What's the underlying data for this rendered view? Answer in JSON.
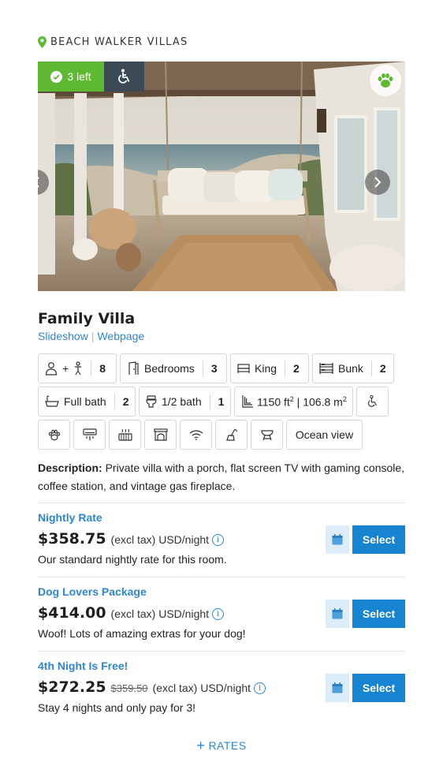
{
  "location": {
    "text": "BEACH WALKER VILLAS",
    "icon": "map-pin-icon"
  },
  "photo": {
    "availability_label": "3 left",
    "accessible_icon": "wheelchair-icon",
    "pet_icon": "paw-icon",
    "next_icon": "chevron-right-icon"
  },
  "room": {
    "title": "Family Villa",
    "links": {
      "slideshow": "Slideshow",
      "separator": "|",
      "webpage": "Webpage"
    }
  },
  "amenities": {
    "occupancy": {
      "icon": "adult-child-icon",
      "label": "+",
      "count": "8"
    },
    "bedrooms": {
      "icon": "door-icon",
      "label": "Bedrooms",
      "count": "3"
    },
    "king": {
      "icon": "king-bed-icon",
      "label": "King",
      "count": "2"
    },
    "bunk": {
      "icon": "bunk-bed-icon",
      "label": "Bunk",
      "count": "2"
    },
    "full_bath": {
      "icon": "bathtub-icon",
      "label": "Full bath",
      "count": "2"
    },
    "half_bath": {
      "icon": "toilet-icon",
      "label": "1/2 bath",
      "count": "1"
    },
    "area": {
      "icon": "area-icon",
      "ft": "1150 ft",
      "sq": "2",
      "sep": " | ",
      "m": "106.8 m"
    },
    "features": [
      "wheelchair-icon",
      "paw-icon",
      "air-conditioner-icon",
      "heater-icon",
      "fireplace-icon",
      "wifi-icon",
      "vacuum-icon",
      "bbq-grill-icon"
    ],
    "view": "Ocean view"
  },
  "description": {
    "label": "Description:",
    "text": " Private villa with a porch, flat screen TV with gaming console, coffee station, and vintage gas fireplace."
  },
  "rates": [
    {
      "name": "Nightly Rate",
      "amount": "$358.75",
      "old": "",
      "unit": "(excl tax) USD/night",
      "desc": "Our standard nightly rate for this room.",
      "select": "Select"
    },
    {
      "name": "Dog Lovers Package",
      "amount": "$414.00",
      "old": "",
      "unit": "(excl tax) USD/night",
      "desc": "Woof! Lots of amazing extras for your dog!",
      "select": "Select"
    },
    {
      "name": "4th Night Is Free!",
      "amount": "$272.25",
      "old": "$359.50",
      "unit": "(excl tax) USD/night",
      "desc": "Stay 4 nights and only pay for 3!",
      "select": "Select"
    }
  ],
  "more_rates": {
    "plus": "+",
    "label": "RATES"
  },
  "colors": {
    "accent": "#2e86d1",
    "select_button": "#1784d2",
    "availability": "#5fb832",
    "badge_dark": "#3c4a55"
  }
}
